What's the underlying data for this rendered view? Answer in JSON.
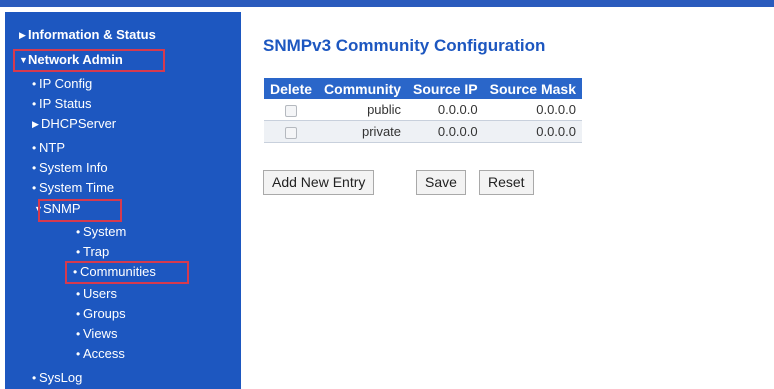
{
  "sidebar": {
    "items": [
      {
        "label": "Information & Status",
        "marker": "▶"
      },
      {
        "label": "Network Admin",
        "marker": "▼"
      },
      {
        "label": "IP Config",
        "marker": "•"
      },
      {
        "label": "IP Status",
        "marker": "•"
      },
      {
        "label": "DHCPServer",
        "marker": "▶"
      },
      {
        "label": "NTP",
        "marker": "•"
      },
      {
        "label": "System Info",
        "marker": "•"
      },
      {
        "label": "System Time",
        "marker": "•"
      },
      {
        "label": "SNMP",
        "marker": "▼"
      },
      {
        "label": "System",
        "marker": "•"
      },
      {
        "label": "Trap",
        "marker": "•"
      },
      {
        "label": "Communities",
        "marker": "•"
      },
      {
        "label": "Users",
        "marker": "•"
      },
      {
        "label": "Groups",
        "marker": "•"
      },
      {
        "label": "Views",
        "marker": "•"
      },
      {
        "label": "Access",
        "marker": "•"
      },
      {
        "label": "SysLog",
        "marker": "•"
      }
    ]
  },
  "main": {
    "title": "SNMPv3 Community Configuration",
    "columns": [
      "Delete",
      "Community",
      "Source IP",
      "Source Mask"
    ],
    "rows": [
      {
        "community": "public",
        "source_ip": "0.0.0.0",
        "source_mask": "0.0.0.0"
      },
      {
        "community": "private",
        "source_ip": "0.0.0.0",
        "source_mask": "0.0.0.0"
      }
    ],
    "buttons": {
      "add": "Add New Entry",
      "save": "Save",
      "reset": "Reset"
    }
  },
  "colors": {
    "sidebar_bg": "#1d57c0",
    "header_bg": "#2a66c9",
    "highlight": "#d63a4e",
    "title": "#1d57c0"
  }
}
